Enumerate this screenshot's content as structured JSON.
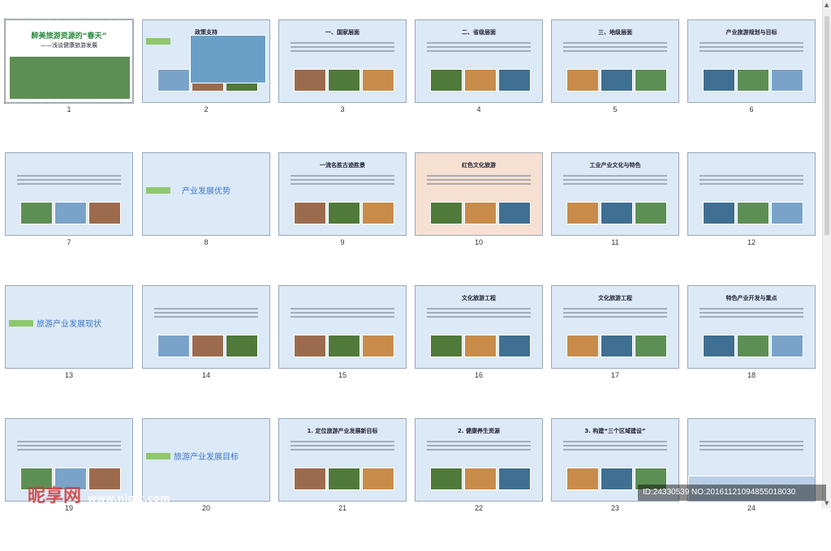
{
  "slides": [
    {
      "n": "1",
      "title": "醉美旅游资源的“春天”",
      "sub": "——浅谈健康旅游发展"
    },
    {
      "n": "2",
      "title": "政策支持"
    },
    {
      "n": "3",
      "title": "一、国家层面"
    },
    {
      "n": "4",
      "title": "二、省级层面"
    },
    {
      "n": "5",
      "title": "三、地级层面"
    },
    {
      "n": "6",
      "title": "产业旅游规划与目标"
    },
    {
      "n": "7",
      "title": ""
    },
    {
      "n": "8",
      "title": "产业发展优势"
    },
    {
      "n": "9",
      "title": "一流名胜古迹胜景"
    },
    {
      "n": "10",
      "title": "红色文化旅游"
    },
    {
      "n": "11",
      "title": "工业产业文化与特色"
    },
    {
      "n": "12",
      "title": ""
    },
    {
      "n": "13",
      "title": "旅游产业发展现状"
    },
    {
      "n": "14",
      "title": ""
    },
    {
      "n": "15",
      "title": ""
    },
    {
      "n": "16",
      "title": "文化旅游工程"
    },
    {
      "n": "17",
      "title": "文化旅游工程"
    },
    {
      "n": "18",
      "title": "特色产业开发与重点"
    },
    {
      "n": "19",
      "title": ""
    },
    {
      "n": "20",
      "title": "旅游产业发展目标"
    },
    {
      "n": "21",
      "title": "1. 定位旅游产业发展新目标"
    },
    {
      "n": "22",
      "title": "2. 健康养生资源"
    },
    {
      "n": "23",
      "title": "3. 构建“三个区域建设”"
    },
    {
      "n": "24",
      "title": ""
    }
  ],
  "watermark": {
    "brand": "昵享网",
    "url": "www.nipic.com",
    "id": "ID:24330539 NO:20161121094855018030"
  },
  "colors": {
    "slide_bg": "#dce9f6",
    "accent_green": "#8fc76d",
    "accent_blue": "#3a78c6"
  }
}
